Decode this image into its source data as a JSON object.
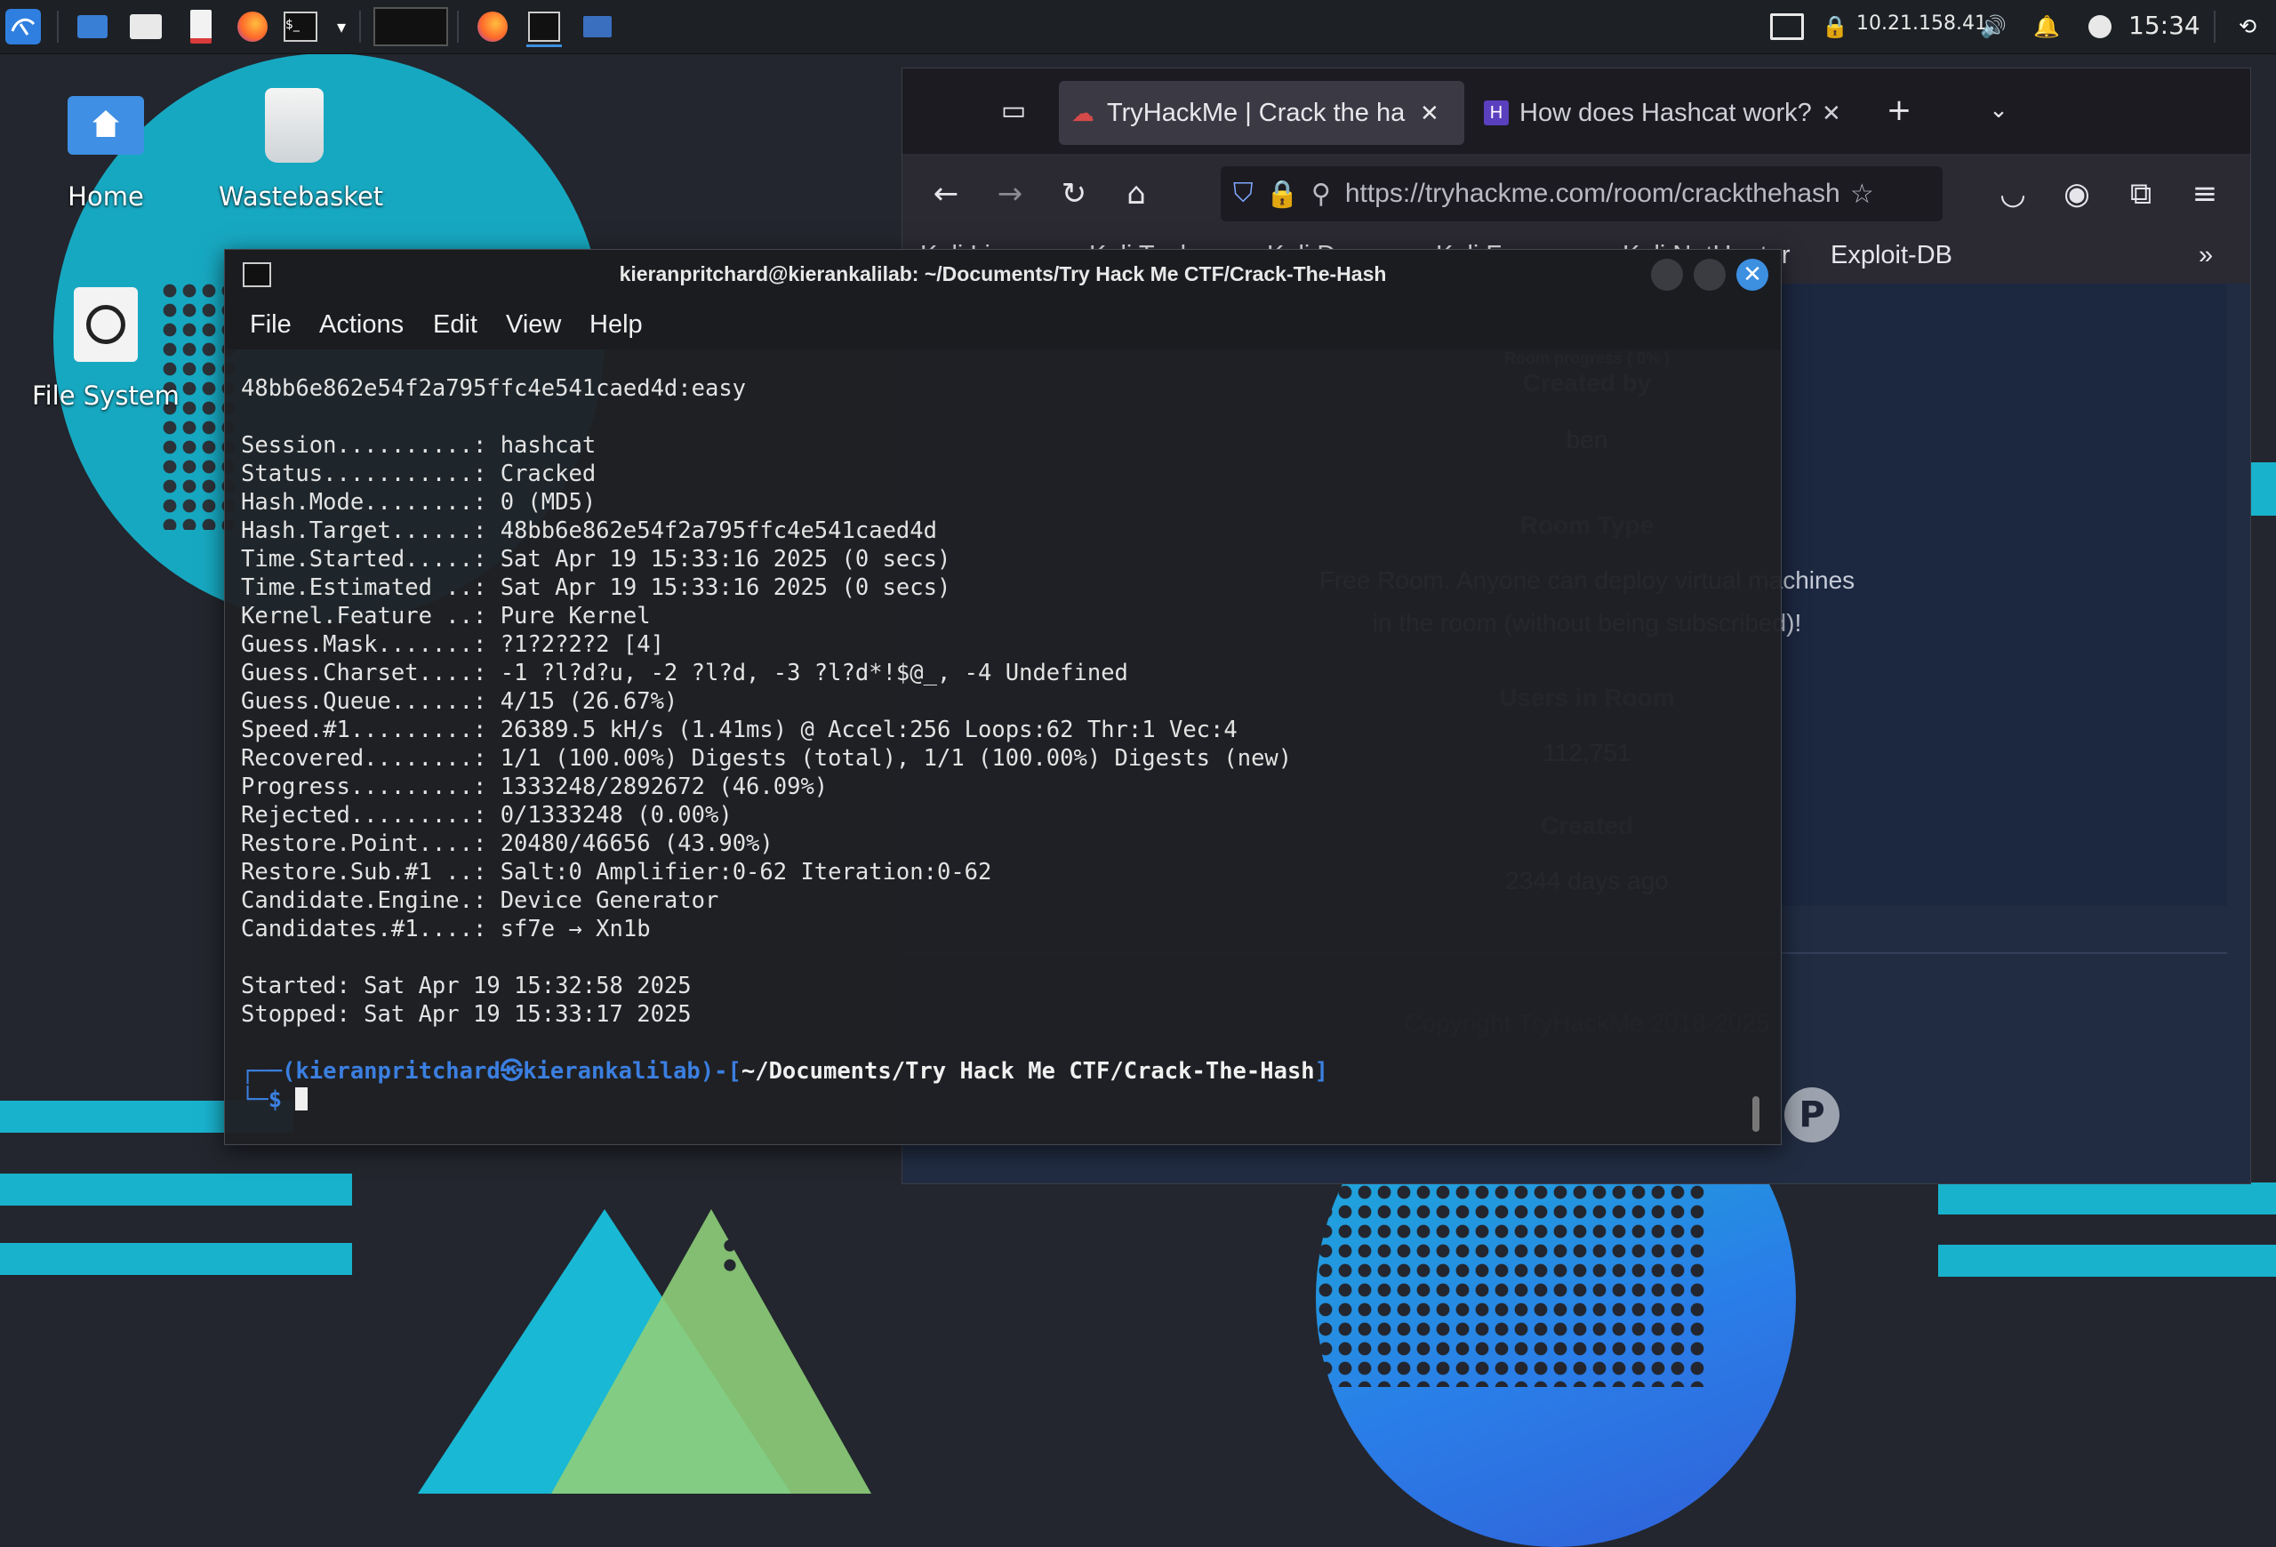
{
  "taskbar": {
    "network_ip": "10.21.158.41",
    "clock": "15:34"
  },
  "desktop": {
    "icons": [
      {
        "label": "Home"
      },
      {
        "label": "Wastebasket"
      },
      {
        "label": "File System"
      }
    ]
  },
  "browser": {
    "tabs": [
      {
        "label": "TryHackMe | Crack the ha"
      },
      {
        "label": "How does Hashcat work?"
      }
    ],
    "url": "https://tryhackme.com/room/crackthehash",
    "bookmarks": [
      "Kali Linux",
      "Kali Tools",
      "Kali Docs",
      "Kali Forums",
      "Kali NetHunter",
      "Exploit-DB"
    ],
    "page": {
      "room_progress": "Room progress ( 0% )",
      "created_by_heading": "Created by",
      "creator": "ben",
      "room_type_heading": "Room Type",
      "room_type_text_1": "Free Room. Anyone can deploy virtual machines",
      "room_type_text_2": "in the room (without being subscribed)!",
      "users_heading": "Users in Room",
      "users_count": "112,751",
      "created_heading": "Created",
      "created_value": "2344 days ago",
      "copyright": "Copyright TryHackMe 2018-2025"
    }
  },
  "terminal": {
    "title": "kieranpritchard@kierankalilab: ~/Documents/Try Hack Me CTF/Crack-The-Hash",
    "menu": [
      "File",
      "Actions",
      "Edit",
      "View",
      "Help"
    ],
    "cracked_line": "48bb6e862e54f2a795ffc4e541caed4d:easy",
    "status_lines": [
      {
        "key": "Session..........:",
        "value": "hashcat"
      },
      {
        "key": "Status...........:",
        "value": "Cracked"
      },
      {
        "key": "Hash.Mode........:",
        "value": "0 (MD5)"
      },
      {
        "key": "Hash.Target......:",
        "value": "48bb6e862e54f2a795ffc4e541caed4d"
      },
      {
        "key": "Time.Started.....:",
        "value": "Sat Apr 19 15:33:16 2025 (0 secs)"
      },
      {
        "key": "Time.Estimated ..:",
        "value": "Sat Apr 19 15:33:16 2025 (0 secs)"
      },
      {
        "key": "Kernel.Feature ..:",
        "value": "Pure Kernel"
      },
      {
        "key": "Guess.Mask.......:",
        "value": "?1?2?2?2 [4]"
      },
      {
        "key": "Guess.Charset....:",
        "value": "-1 ?l?d?u, -2 ?l?d, -3 ?l?d*!$@_, -4 Undefined"
      },
      {
        "key": "Guess.Queue......:",
        "value": "4/15 (26.67%)"
      },
      {
        "key": "Speed.#1.........:",
        "value": "26389.5 kH/s (1.41ms) @ Accel:256 Loops:62 Thr:1 Vec:4"
      },
      {
        "key": "Recovered........:",
        "value": "1/1 (100.00%) Digests (total), 1/1 (100.00%) Digests (new)"
      },
      {
        "key": "Progress.........:",
        "value": "1333248/2892672 (46.09%)"
      },
      {
        "key": "Rejected.........:",
        "value": "0/1333248 (0.00%)"
      },
      {
        "key": "Restore.Point....:",
        "value": "20480/46656 (43.90%)"
      },
      {
        "key": "Restore.Sub.#1 ..:",
        "value": "Salt:0 Amplifier:0-62 Iteration:0-62"
      },
      {
        "key": "Candidate.Engine.:",
        "value": "Device Generator"
      },
      {
        "key": "Candidates.#1....:",
        "value": "sf7e → Xn1b"
      }
    ],
    "started_line": "Started: Sat Apr 19 15:32:58 2025",
    "stopped_line": "Stopped: Sat Apr 19 15:33:17 2025",
    "prompt": {
      "corner_top": "┌──(",
      "user_host": "kieranpritchard㉿kierankalilab",
      "mid": ")-[",
      "path": "~/Documents/Try Hack Me CTF/Crack-The-Hash",
      "end": "]",
      "corner_bottom": "└─",
      "symbol": "$"
    }
  }
}
